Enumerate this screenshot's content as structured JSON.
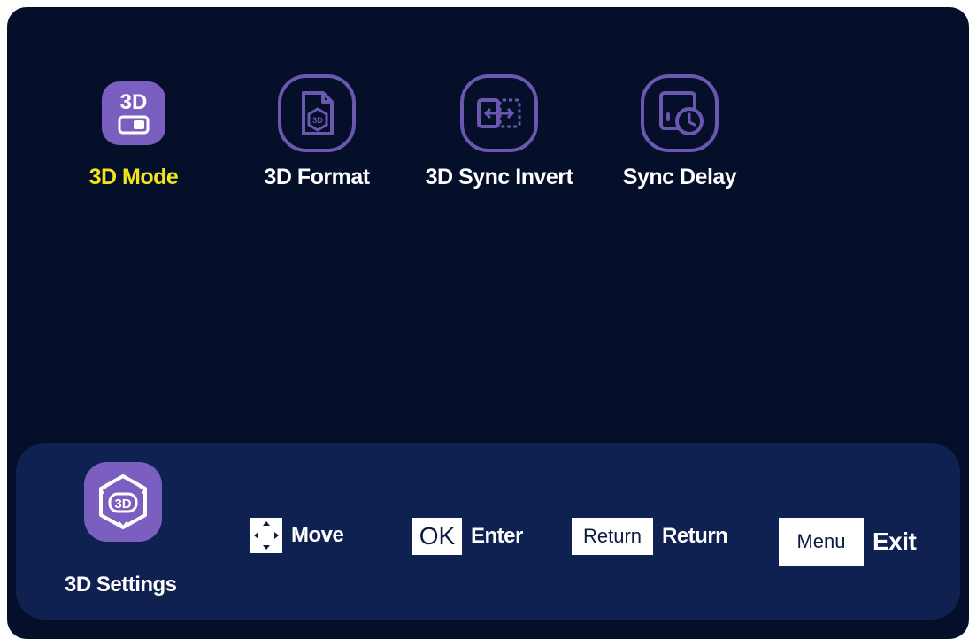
{
  "menu": {
    "items": [
      {
        "label": "3D Mode",
        "icon": "3d-toggle-icon",
        "selected": true
      },
      {
        "label": "3D Format",
        "icon": "3d-format-document-icon",
        "selected": false
      },
      {
        "label": "3D Sync Invert",
        "icon": "sync-invert-icon",
        "selected": false
      },
      {
        "label": "Sync Delay",
        "icon": "sync-delay-clock-icon",
        "selected": false
      }
    ],
    "selected_color": "#f2e51c"
  },
  "footer": {
    "section_icon": "3d-cube-icon",
    "section_label": "3D Settings",
    "hints": [
      {
        "key": "",
        "key_icon": "dpad-arrows-icon",
        "label": "Move"
      },
      {
        "key": "OK",
        "label": "Enter"
      },
      {
        "key": "Return",
        "label": "Return"
      },
      {
        "key": "Menu",
        "label": "Exit"
      }
    ]
  },
  "icon_glyphs": {
    "3d_mode_text": "3D",
    "format_badge_text": "3D",
    "cube_text": "3D"
  },
  "colors": {
    "background": "#050f2a",
    "footer_panel": "#0f2151",
    "accent_purple": "#7a5fc0",
    "outline_purple": "#6a57b0"
  }
}
